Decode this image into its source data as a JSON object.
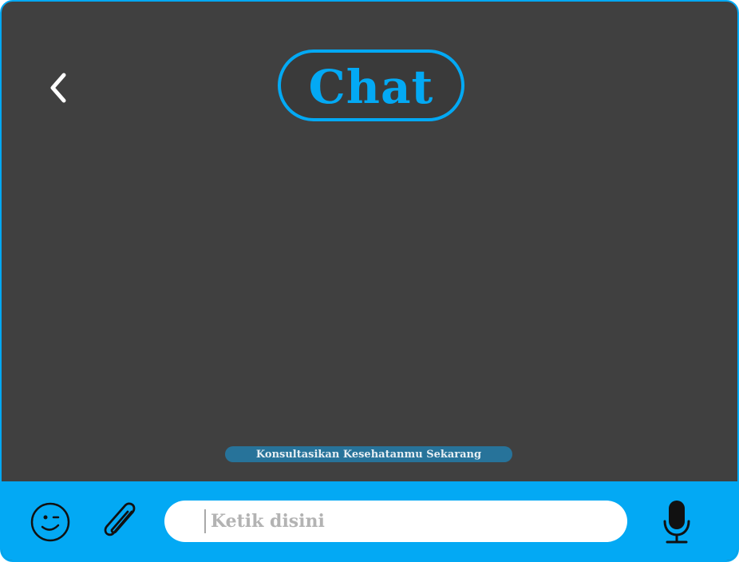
{
  "header": {
    "title": "Chat",
    "back_icon": "chevron-left-icon"
  },
  "hint": {
    "text": "Konsultasikan Kesehatanmu Sekarang"
  },
  "composer": {
    "emoji_icon": "smiley-icon",
    "attach_icon": "paperclip-icon",
    "input_placeholder": "Ketik disini",
    "input_value": "",
    "mic_icon": "microphone-icon"
  },
  "colors": {
    "accent": "#03a9f4",
    "background": "#404040",
    "hint_bar": "#27739a",
    "input_bg": "#ffffff"
  }
}
